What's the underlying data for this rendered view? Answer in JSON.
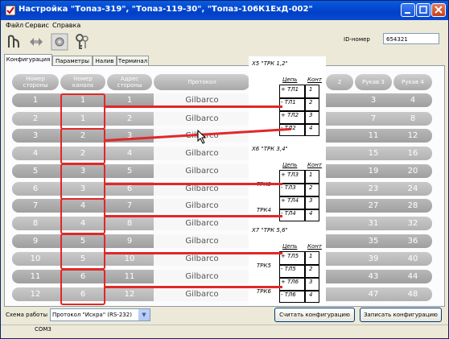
{
  "window": {
    "title": "Настройка \"Топаз-319\", \"Топаз-119-30\", \"Топаз-106К1ЕхД-002\""
  },
  "menu": [
    "Файл",
    "Сервис",
    "Справка"
  ],
  "toolbar": {
    "icons": [
      "fuel-pump-icon",
      "exchange-icon",
      "settings-icon",
      "keys-icon"
    ]
  },
  "id_field": {
    "label": "ID-номер",
    "value": "654321"
  },
  "tabs": [
    "Конфигурация",
    "Параметры",
    "Налив",
    "Терминал"
  ],
  "table": {
    "headers": {
      "side": "Номер\nстороны",
      "channel": "Номер\nканала",
      "address": "Адрес\nстороны",
      "protocol": "Протокол",
      "hose2": "2",
      "hose3": "Рукав 3",
      "hose4": "Рукав 4"
    },
    "rows": [
      {
        "side": "1",
        "channel": "1",
        "address": "1",
        "protocol": "Gilbarco",
        "h2": "",
        "h3": "3",
        "h4": "4"
      },
      {
        "side": "2",
        "channel": "1",
        "address": "2",
        "protocol": "Gilbarco",
        "h2": "",
        "h3": "7",
        "h4": "8"
      },
      {
        "side": "3",
        "channel": "2",
        "address": "3",
        "protocol": "Gilbarco",
        "h2": "",
        "h3": "11",
        "h4": "12"
      },
      {
        "side": "4",
        "channel": "2",
        "address": "4",
        "protocol": "Gilbarco",
        "h2": "",
        "h3": "15",
        "h4": "16"
      },
      {
        "side": "5",
        "channel": "3",
        "address": "5",
        "protocol": "Gilbarco",
        "h2": "",
        "h3": "19",
        "h4": "20"
      },
      {
        "side": "6",
        "channel": "3",
        "address": "6",
        "protocol": "Gilbarco",
        "h2": "",
        "h3": "23",
        "h4": "24"
      },
      {
        "side": "7",
        "channel": "4",
        "address": "7",
        "protocol": "Gilbarco",
        "h2": "",
        "h3": "27",
        "h4": "28"
      },
      {
        "side": "8",
        "channel": "4",
        "address": "8",
        "protocol": "Gilbarco",
        "h2": "",
        "h3": "31",
        "h4": "32"
      },
      {
        "side": "9",
        "channel": "5",
        "address": "9",
        "protocol": "Gilbarco",
        "h2": "",
        "h3": "35",
        "h4": "36"
      },
      {
        "side": "10",
        "channel": "5",
        "address": "10",
        "protocol": "Gilbarco",
        "h2": "",
        "h3": "39",
        "h4": "40"
      },
      {
        "side": "11",
        "channel": "6",
        "address": "11",
        "protocol": "Gilbarco",
        "h2": "",
        "h3": "43",
        "h4": "44"
      },
      {
        "side": "12",
        "channel": "6",
        "address": "12",
        "protocol": "Gilbarco",
        "h2": "",
        "h3": "47",
        "h4": "48"
      }
    ]
  },
  "overlay": {
    "blocks": [
      {
        "title": "X5 \"ТРК 1,2\"",
        "col1": "Цепь",
        "col2": "Конт",
        "rows": [
          [
            "+ ТЛ1",
            "1"
          ],
          [
            "- ТЛ1",
            "2"
          ],
          [
            "+ ТЛ2",
            "3"
          ],
          [
            "- ТЛ2",
            "4"
          ]
        ],
        "side_label": ""
      },
      {
        "title": "X6 \"ТРК 3,4\"",
        "col1": "Цепь",
        "col2": "Конт",
        "rows": [
          [
            "+ ТЛ3",
            "1"
          ],
          [
            "- ТЛ3",
            "2"
          ],
          [
            "+ ТЛ4",
            "3"
          ],
          [
            "- ТЛ4",
            "4"
          ]
        ],
        "side_labels": [
          "ТРК3",
          "ТРК4"
        ]
      },
      {
        "title": "X7 \"ТРК 5,6\"",
        "col1": "Цепь",
        "col2": "Конт",
        "rows": [
          [
            "+ ТЛ5",
            "1"
          ],
          [
            "- ТЛ5",
            "2"
          ],
          [
            "+ ТЛ6",
            "3"
          ],
          [
            "- ТЛ6",
            "4"
          ]
        ],
        "side_labels": [
          "ТРК5",
          "ТРК6"
        ]
      }
    ]
  },
  "bottom": {
    "scheme_label": "Схема работы",
    "scheme_value": "Протокол \"Искра\" (RS-232)",
    "read_button": "Считать конфигурацию",
    "write_button": "Записать конфигурацию"
  },
  "status": {
    "port": "COM3"
  },
  "colors": {
    "title_bar": "#0a4ad0",
    "row_dark": "#a9a9a9",
    "row_light": "#c4c4c4",
    "highlight": "#e02828"
  }
}
